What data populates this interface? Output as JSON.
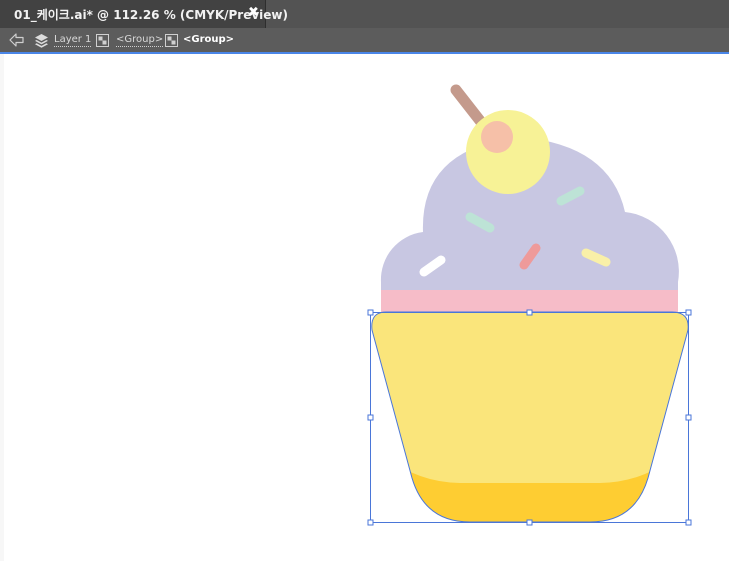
{
  "document_tab": {
    "title": "01_케이크.ai* @ 112.26 % (CMYK/Preview)",
    "close_glyph": "✖"
  },
  "isolation_bar": {
    "back_icon": "arrow-left-icon",
    "crumbs": [
      {
        "label": "Layer 1",
        "icon": "layers-icon"
      },
      {
        "label": "<Group>",
        "icon": "group-icon"
      },
      {
        "label": "<Group>",
        "icon": "group-icon",
        "current": true
      }
    ],
    "accent_color": "#4a86e8"
  },
  "artwork": {
    "name": "cupcake",
    "selection_color": "#4a76d8",
    "colors": {
      "frosting": "#c8c7e2",
      "frosting_band": "#f6bcc8",
      "cup": "#fae57b",
      "cup_bottom": "#fecd32",
      "cherry": "#f7f296",
      "cherry_highlight": "#f6c0a8",
      "stem": "#c49a8c",
      "sprinkle_white": "#ffffff",
      "sprinkle_mint": "#bde3d6",
      "sprinkle_red": "#ee9a9a",
      "sprinkle_yellow": "#f9f0a8"
    }
  }
}
